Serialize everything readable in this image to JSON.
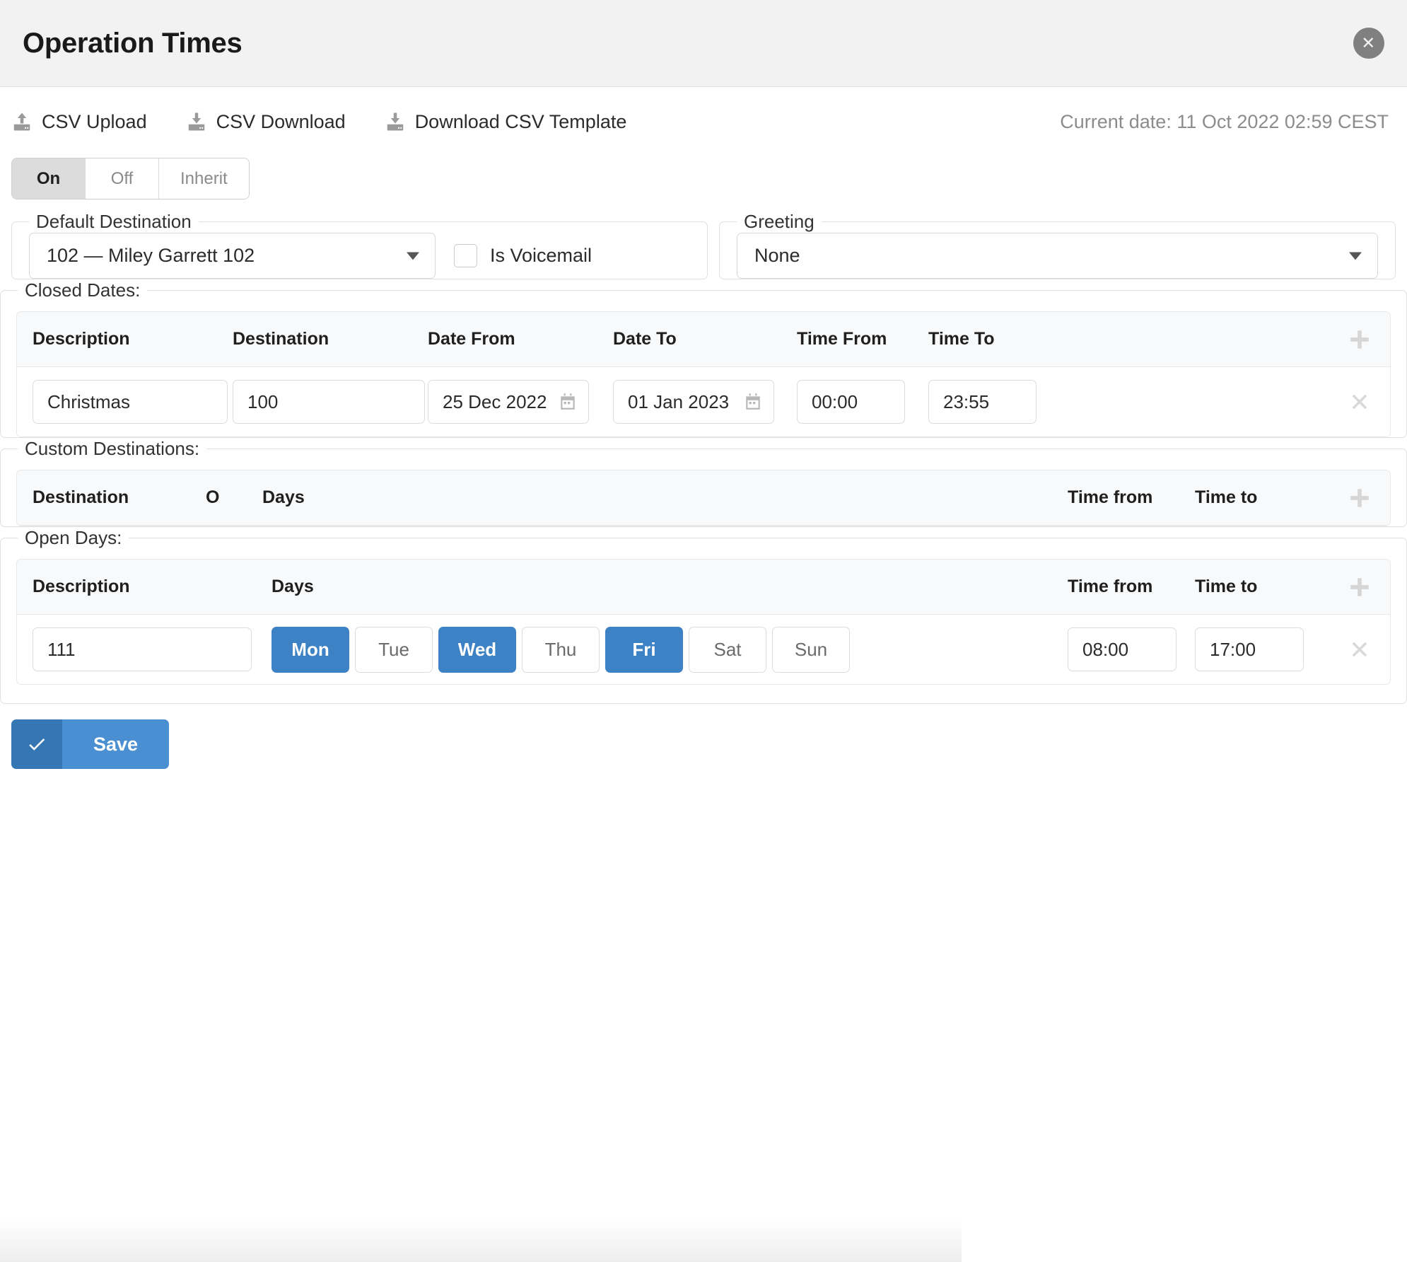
{
  "header": {
    "title": "Operation Times",
    "close_icon": "close-circle-icon"
  },
  "toolbar": {
    "links": [
      {
        "label": "CSV Upload",
        "icon": "upload-icon"
      },
      {
        "label": "CSV Download",
        "icon": "download-icon"
      },
      {
        "label": "Download CSV Template",
        "icon": "download-icon"
      }
    ],
    "current_date": "Current date: 11 Oct 2022 02:59 CEST"
  },
  "mode_toggle": {
    "options": [
      "On",
      "Off",
      "Inherit"
    ],
    "selected": "On"
  },
  "default_destination": {
    "legend": "Default Destination",
    "select_value": "102  —  Miley Garrett 102",
    "checkbox_label": "Is Voicemail",
    "checkbox_checked": false
  },
  "greeting": {
    "legend": "Greeting",
    "select_value": "None"
  },
  "closed_dates": {
    "legend": "Closed Dates:",
    "columns": [
      "Description",
      "Destination",
      "Date From",
      "Date To",
      "Time From",
      "Time To"
    ],
    "add_icon": "plus-icon",
    "rows": [
      {
        "description": "Christmas",
        "destination": "100",
        "date_from": "25 Dec 2022",
        "date_to": "01 Jan 2023",
        "time_from": "00:00",
        "time_to": "23:55",
        "delete_icon": "close-x-icon"
      }
    ]
  },
  "custom_destinations": {
    "legend": "Custom Destinations:",
    "columns": [
      "Destination",
      "O",
      "Days",
      "Time from",
      "Time to"
    ],
    "add_icon": "plus-icon",
    "rows": []
  },
  "open_days": {
    "legend": "Open Days:",
    "columns": [
      "Description",
      "Days",
      "Time from",
      "Time to"
    ],
    "add_icon": "plus-icon",
    "rows": [
      {
        "description": "111",
        "days": [
          {
            "label": "Mon",
            "selected": true
          },
          {
            "label": "Tue",
            "selected": false
          },
          {
            "label": "Wed",
            "selected": true
          },
          {
            "label": "Thu",
            "selected": false
          },
          {
            "label": "Fri",
            "selected": true
          },
          {
            "label": "Sat",
            "selected": false
          },
          {
            "label": "Sun",
            "selected": false
          }
        ],
        "time_from": "08:00",
        "time_to": "17:00",
        "delete_icon": "close-x-icon"
      }
    ]
  },
  "save": {
    "label": "Save",
    "icon": "check-icon"
  },
  "colors": {
    "accent": "#3d82c4",
    "save_primary": "#4a8fd1",
    "save_icon_bg": "#3577b5",
    "header_bg": "#f2f2f2",
    "table_head_bg": "#f8f9fa",
    "muted_text": "#8c8c8c"
  }
}
